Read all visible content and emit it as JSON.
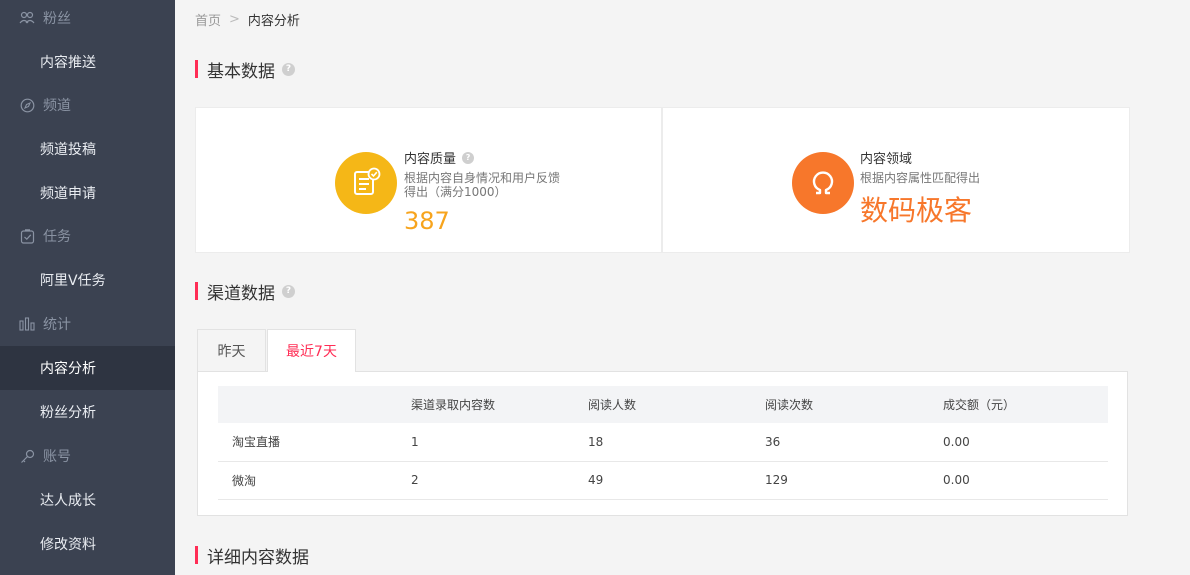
{
  "sidebar": {
    "groups": [
      {
        "label": "粉丝",
        "icon": "fans-icon"
      },
      {
        "label": "频道",
        "icon": "compass-icon"
      },
      {
        "label": "任务",
        "icon": "clipboard-check-icon"
      },
      {
        "label": "统计",
        "icon": "bar-chart-icon"
      },
      {
        "label": "账号",
        "icon": "key-icon"
      }
    ],
    "items": [
      {
        "label": "内容推送"
      },
      {
        "label": "频道投稿"
      },
      {
        "label": "频道申请"
      },
      {
        "label": "阿里V任务"
      },
      {
        "label": "内容分析"
      },
      {
        "label": "粉丝分析"
      },
      {
        "label": "达人成长"
      },
      {
        "label": "修改资料"
      }
    ],
    "active_item": "内容分析"
  },
  "breadcrumb": {
    "home": "首页",
    "separator": ">",
    "current": "内容分析"
  },
  "sections": {
    "basic": "基本数据",
    "channel": "渠道数据",
    "detail": "详细内容数据"
  },
  "stats": {
    "quality": {
      "title": "内容质量",
      "desc_line1": "根据内容自身情况和用户反馈",
      "desc_line2": "得出（满分1000）",
      "value": "387",
      "icon": "document-check-icon",
      "color": "#f5b717"
    },
    "domain": {
      "title": "内容领域",
      "desc": "根据内容属性匹配得出",
      "value": "数码极客",
      "icon": "omega-icon",
      "color": "#f7772b"
    }
  },
  "tabs": [
    {
      "label": "昨天"
    },
    {
      "label": "最近7天"
    }
  ],
  "active_tab": "最近7天",
  "table": {
    "headers": [
      "",
      "渠道录取内容数",
      "阅读人数",
      "阅读次数",
      "成交额（元）"
    ],
    "rows": [
      [
        "淘宝直播",
        "1",
        "18",
        "36",
        "0.00"
      ],
      [
        "微淘",
        "2",
        "49",
        "129",
        "0.00"
      ]
    ]
  },
  "colors": {
    "accent": "#ff2d55",
    "sidebar_bg": "#3b4251",
    "sidebar_active": "#2e3441"
  }
}
